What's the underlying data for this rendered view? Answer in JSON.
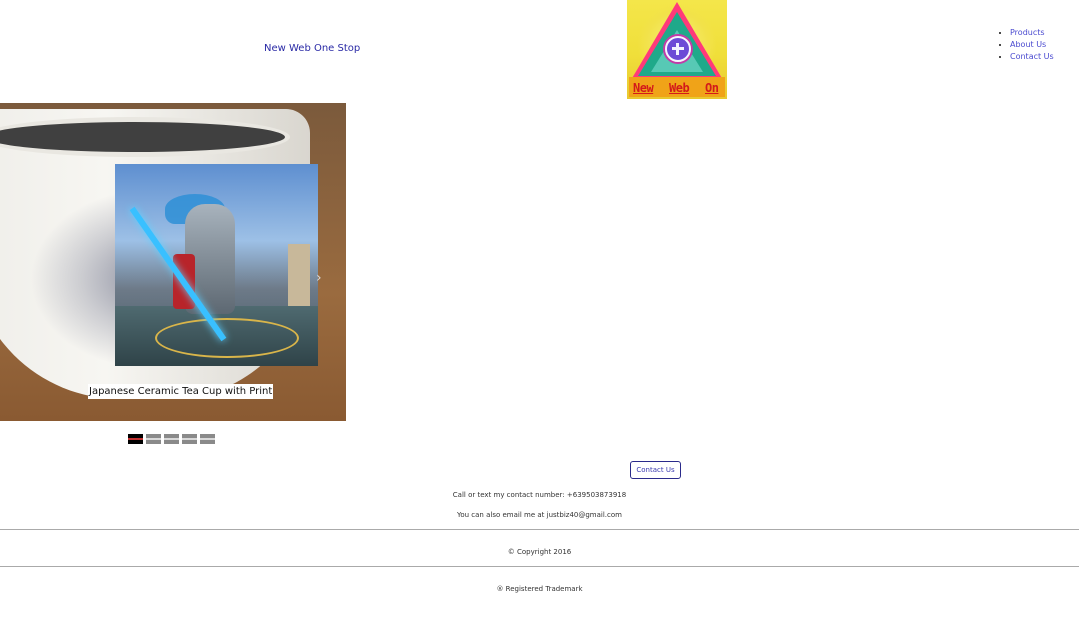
{
  "header": {
    "brand": "New Web One Stop",
    "logo": {
      "words": [
        "New",
        "Web",
        "On"
      ]
    },
    "nav": [
      {
        "label": "Products"
      },
      {
        "label": "About Us"
      },
      {
        "label": "Contact Us"
      }
    ]
  },
  "slider": {
    "caption": "Japanese Ceramic Tea Cup with Print",
    "next_icon": "chevron-right-icon",
    "slide_count": 5,
    "active_index": 0
  },
  "contact": {
    "button_label": "Contact Us",
    "phone_line": "Call or text my contact number: +639503873918",
    "email_line": "You can also email me at justbiz40@gmail.com"
  },
  "footer": {
    "copyright": "© Copyright 2016",
    "trademark": "® Registered Trademark"
  },
  "colors": {
    "link": "#4a4ad0",
    "brand": "#2a2aa6",
    "active_dot": "#000000"
  }
}
